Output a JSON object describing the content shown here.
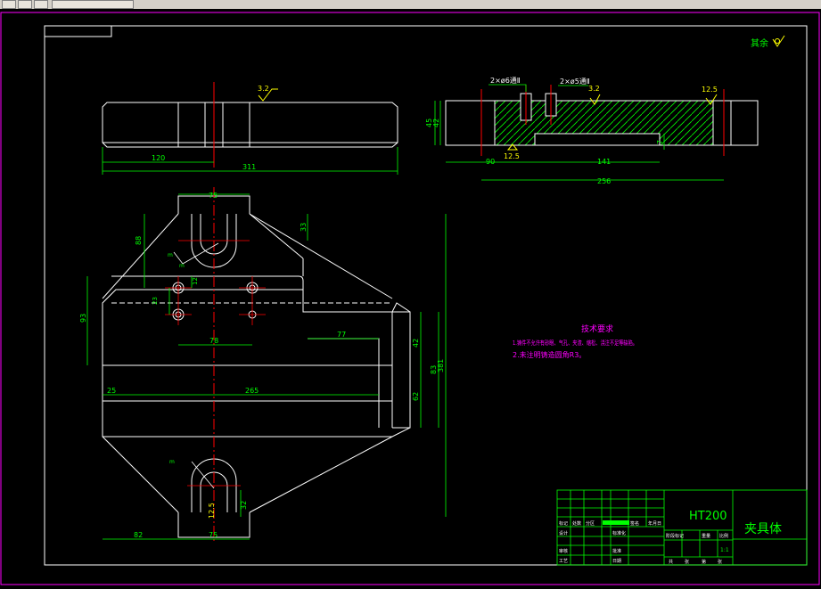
{
  "drawing": {
    "roughness_note": "其余",
    "top_view": {
      "roughness": "3.2",
      "dims": [
        "120",
        "311"
      ]
    },
    "section_view": {
      "labels": [
        "2×ø6通Ⅱ",
        "2×ø5通Ⅱ",
        "3.2",
        "12.5",
        "12.5"
      ],
      "dims": [
        "45",
        "42",
        "7",
        "90",
        "141",
        "256"
      ]
    },
    "plan_view": {
      "dims": [
        "75",
        "88",
        "33",
        "12",
        "23",
        "93",
        "78",
        "77",
        "25",
        "265",
        "42",
        "83",
        "381",
        "62",
        "32",
        "82",
        "75",
        "12.5"
      ],
      "leaders": [
        "m",
        "m",
        "m"
      ]
    },
    "tech_requirements": {
      "title": "技术要求",
      "items": [
        "1.铸件不允许有砂眼、气孔、夹渣、缩松、浇注不足等缺陷。",
        "2.未注明铸造圆角R3。"
      ]
    },
    "title_block": {
      "material": "HT200",
      "part_name": "夹具体",
      "scale": "1:1",
      "row_labels": [
        "标记",
        "处数",
        "分区",
        "更改文件号",
        "签名",
        "年月日"
      ],
      "left_labels": [
        "设计",
        "审核",
        "工艺"
      ],
      "mid_labels": [
        "标准化",
        "批准",
        "日期"
      ],
      "stage_labels": [
        "阶段标记",
        "重量",
        "比例"
      ],
      "bottom": [
        "共",
        "张",
        "第",
        "张"
      ]
    }
  },
  "colors": {
    "background": "#000000",
    "outline": "#ffffff",
    "center_line": "#ff0000",
    "dimension": "#00ff00",
    "text": "#ff00ff",
    "roughness": "#ffff00",
    "frame": "#ff00ff"
  }
}
